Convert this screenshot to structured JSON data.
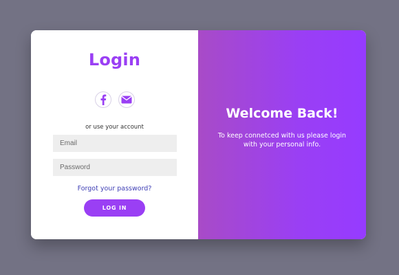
{
  "login_panel": {
    "title": "Login",
    "social": [
      {
        "icon": "facebook-icon"
      },
      {
        "icon": "envelope-icon"
      }
    ],
    "alt_text": "or use your account",
    "email_placeholder": "Email",
    "password_placeholder": "Password",
    "forgot_link": "Forgot your password?",
    "login_button": "LOG IN"
  },
  "welcome_panel": {
    "title": "Welcome Back!",
    "text": "To keep connetced with us please login with your personal info."
  },
  "colors": {
    "accent": "#9a3ff4",
    "background": "#737284",
    "input_bg": "#eeeeee",
    "link": "#3f3fb5"
  }
}
